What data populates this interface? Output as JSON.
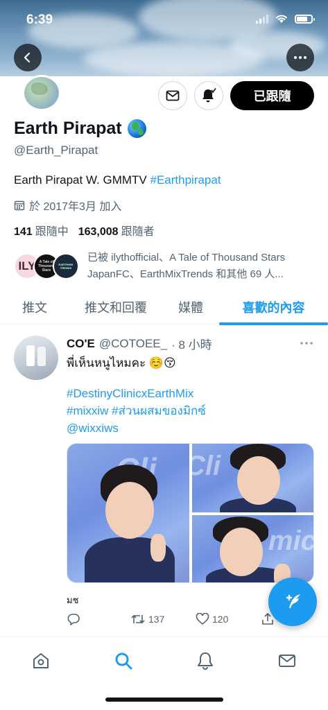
{
  "status_bar": {
    "time": "6:39"
  },
  "profile": {
    "name": "Earth Pirapat",
    "handle": "@Earth_Pirapat",
    "bio_text": "Earth Pirapat W. GMMTV ",
    "bio_hashtag": "#Earthpirapat",
    "joined": "於 2017年3月 加入",
    "following_count": "141",
    "following_label": "跟隨中",
    "followers_count": "163,008",
    "followers_label": "跟隨者",
    "follow_button": "已跟隨",
    "followed_by_line1": "已被 ilythofficial、A Tale of Thousand Stars",
    "followed_by_line2": "JapanFC、EarthMixTrends 和其他 69 人...",
    "followed_by_avatars": [
      "ILY",
      "A Tale of Thousand Stars",
      "EARTHMIX TRENDS"
    ]
  },
  "tabs": [
    {
      "label": "推文"
    },
    {
      "label": "推文和回覆"
    },
    {
      "label": "媒體"
    },
    {
      "label": "喜歡的內容"
    }
  ],
  "tweet": {
    "name": "CO'E",
    "handle": "@COTOEE_",
    "time": "· 8 小時",
    "text": "พี่เห็นหนูไหมคะ ☺️😚",
    "tags": [
      "#DestinyClinicxEarthMix",
      "#mixxiw #ส่วนผสมของมิกซ์",
      "@wixxiws"
    ],
    "caption": "มช",
    "retweets": "137",
    "likes": "120"
  },
  "colors": {
    "accent": "#1d9bf0",
    "text": "#0f1419",
    "muted": "#536471"
  },
  "icons": {
    "back": "back-arrow-icon",
    "more": "more-icon",
    "mail": "mail-icon",
    "bell": "bell-icon",
    "calendar": "calendar-icon",
    "reply": "reply-icon",
    "retweet": "retweet-icon",
    "like": "heart-icon",
    "share": "share-icon",
    "compose": "compose-icon",
    "home": "home-icon",
    "search": "search-icon",
    "notifications": "notifications-icon",
    "messages": "messages-icon"
  }
}
